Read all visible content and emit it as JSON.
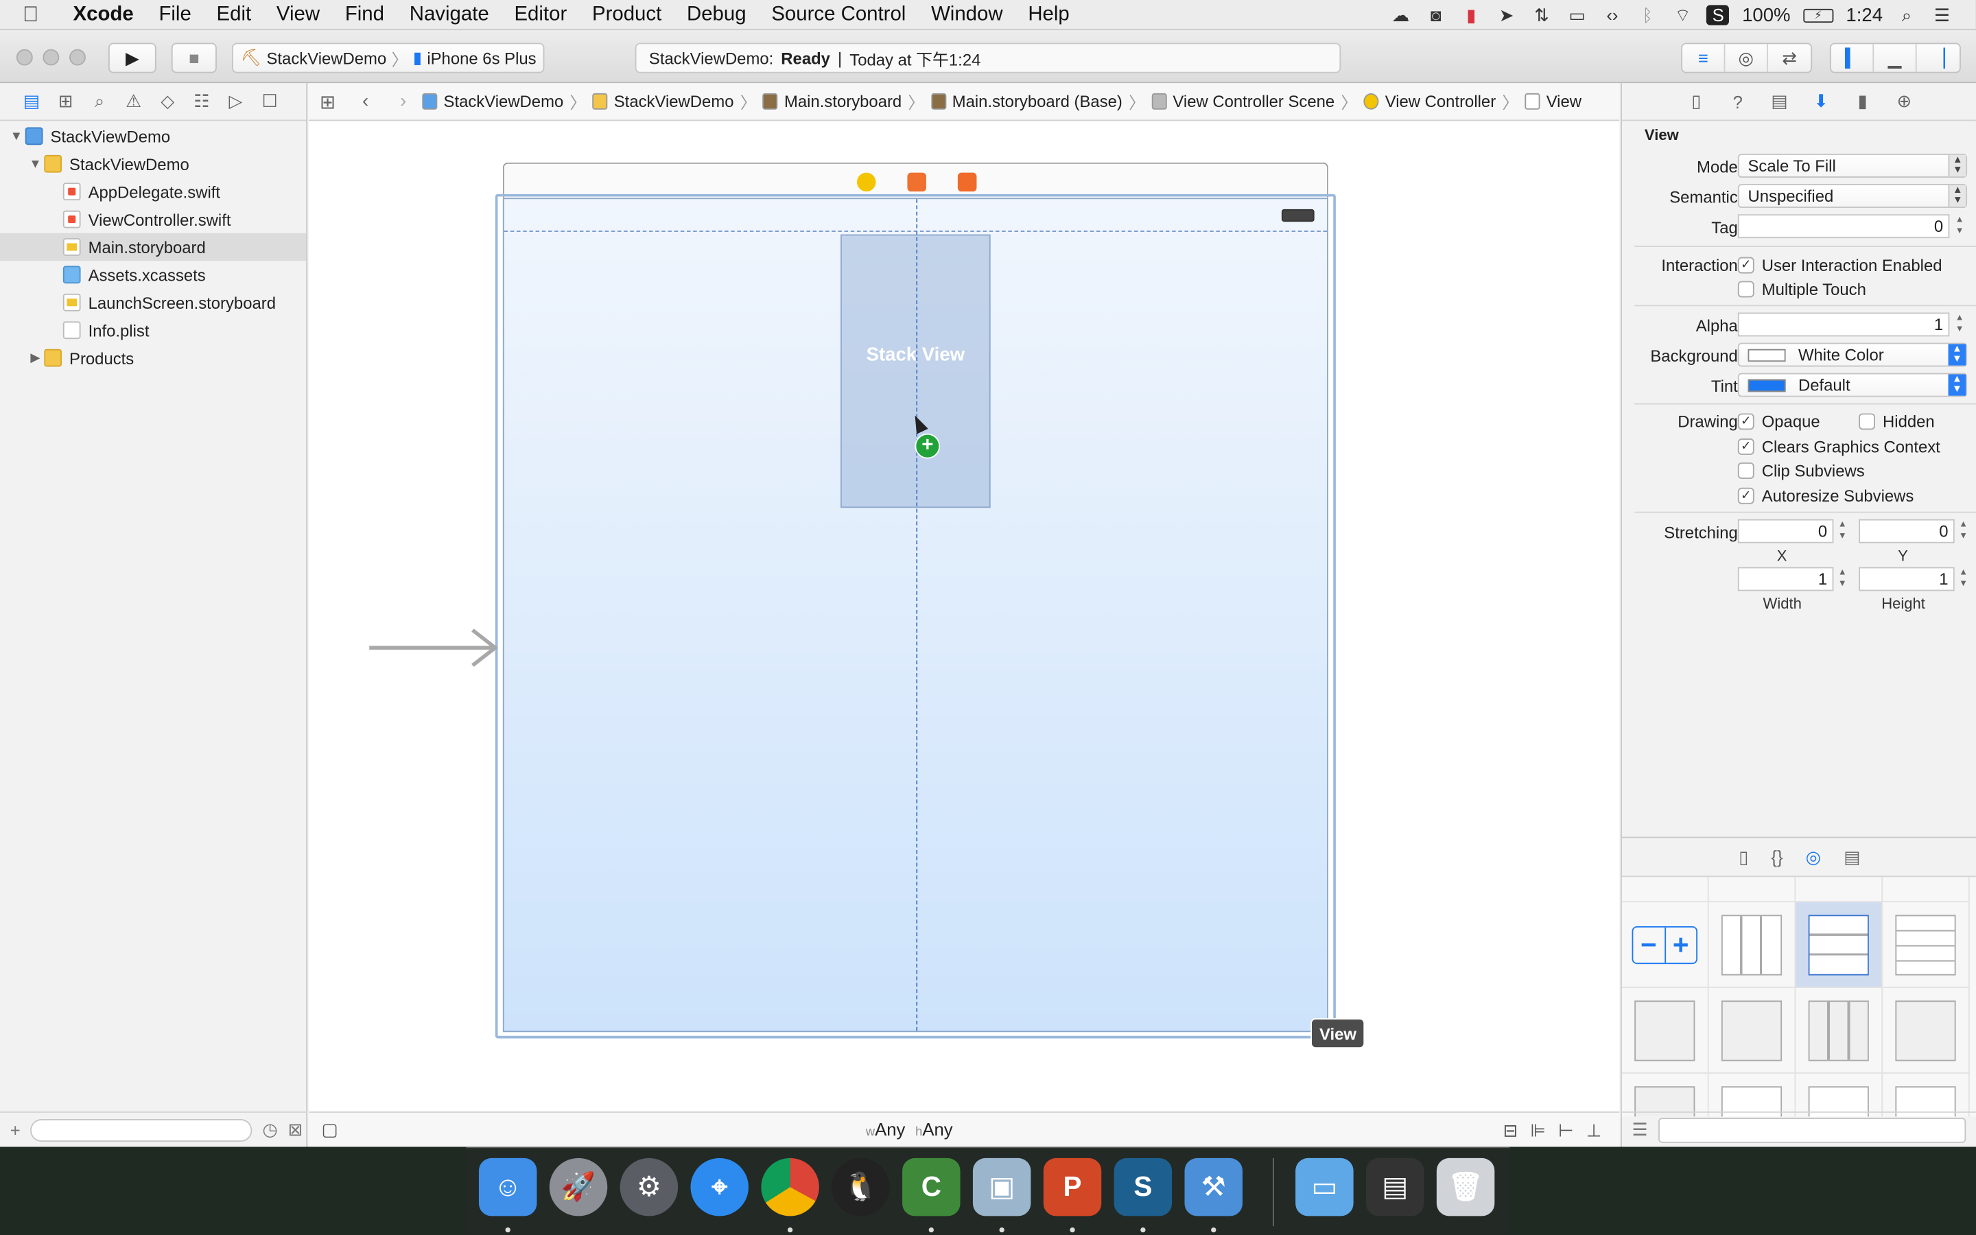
{
  "menubar": {
    "apple": "",
    "items": [
      "Xcode",
      "File",
      "Edit",
      "View",
      "Find",
      "Navigate",
      "Editor",
      "Product",
      "Debug",
      "Source Control",
      "Window",
      "Help"
    ],
    "battery": "100%",
    "clock": "1:24"
  },
  "toolbar": {
    "scheme_name": "StackViewDemo",
    "device": "iPhone 6s Plus",
    "activity_project": "StackViewDemo:",
    "activity_status": "Ready",
    "activity_sep": "|",
    "activity_time": "Today at 下午1:24"
  },
  "navigator": {
    "items": [
      {
        "label": "StackViewDemo",
        "level": 0,
        "type": "proj",
        "disclosure": "▼"
      },
      {
        "label": "StackViewDemo",
        "level": 1,
        "type": "folder",
        "disclosure": "▼"
      },
      {
        "label": "AppDelegate.swift",
        "level": 2,
        "type": "swift"
      },
      {
        "label": "ViewController.swift",
        "level": 2,
        "type": "swift"
      },
      {
        "label": "Main.storyboard",
        "level": 2,
        "type": "sb",
        "selected": true
      },
      {
        "label": "Assets.xcassets",
        "level": 2,
        "type": "assets"
      },
      {
        "label": "LaunchScreen.storyboard",
        "level": 2,
        "type": "sb"
      },
      {
        "label": "Info.plist",
        "level": 2,
        "type": "plist"
      },
      {
        "label": "Products",
        "level": 1,
        "type": "folder",
        "disclosure": "▶"
      }
    ]
  },
  "jumpbar": {
    "crumbs": [
      "StackViewDemo",
      "StackViewDemo",
      "Main.storyboard",
      "Main.storyboard (Base)",
      "View Controller Scene",
      "View Controller",
      "View"
    ]
  },
  "canvas": {
    "stack_view_label": "Stack View",
    "view_tag": "View",
    "size_class_w_prefix": "w",
    "size_class_w": "Any",
    "size_class_h_prefix": "h",
    "size_class_h": "Any"
  },
  "inspector": {
    "section_title": "View",
    "mode_label": "Mode",
    "mode_value": "Scale To Fill",
    "semantic_label": "Semantic",
    "semantic_value": "Unspecified",
    "tag_label": "Tag",
    "tag_value": "0",
    "interaction_label": "Interaction",
    "user_interaction": "User Interaction Enabled",
    "multiple_touch": "Multiple Touch",
    "alpha_label": "Alpha",
    "alpha_value": "1",
    "background_label": "Background",
    "background_value": "White Color",
    "tint_label": "Tint",
    "tint_value": "Default",
    "drawing_label": "Drawing",
    "opaque": "Opaque",
    "hidden": "Hidden",
    "clears_graphics": "Clears Graphics Context",
    "clip_subviews": "Clip Subviews",
    "autoresize_subviews": "Autoresize Subviews",
    "stretching_label": "Stretching",
    "stretch_x": "0",
    "stretch_y": "0",
    "x_label": "X",
    "y_label": "Y",
    "stretch_width": "1",
    "stretch_height": "1",
    "width_label": "Width",
    "height_label": "Height"
  },
  "colors": {
    "accent": "#1b78f2",
    "tint_swatch": "#1b78f2",
    "background_swatch": "#ffffff",
    "scene_icons": [
      "#f5c400",
      "#f07030",
      "#f06a2a"
    ]
  },
  "dock": {
    "apps": [
      "Finder",
      "Launchpad",
      "System Preferences",
      "Safari",
      "Chrome",
      "QQ",
      "Camtasia",
      "Preview",
      "PowerPoint",
      "Snagit",
      "Xcode",
      "Folder",
      "Recorder",
      "Trash"
    ]
  }
}
